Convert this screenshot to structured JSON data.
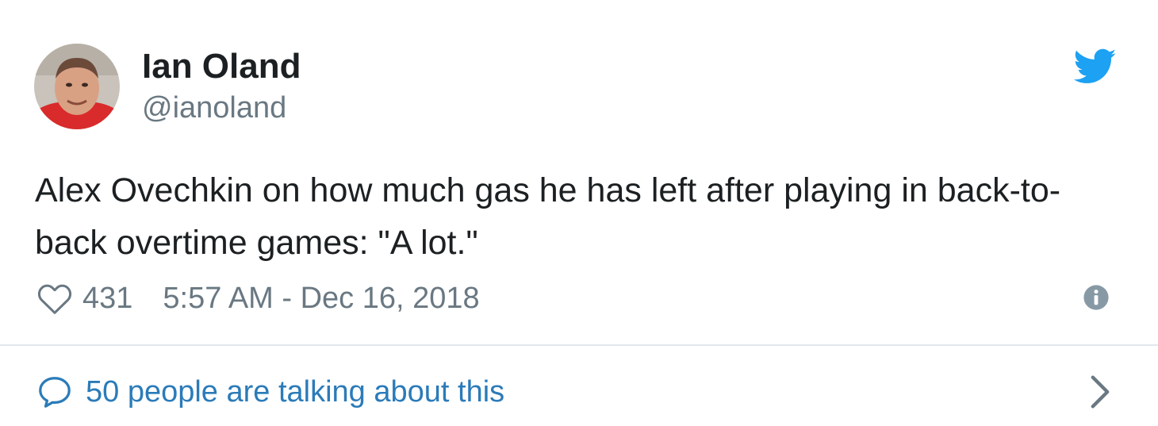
{
  "author": {
    "display_name": "Ian Oland",
    "handle": "@ianoland",
    "avatar_icon": "profile-photo"
  },
  "tweet": {
    "text": "Alex Ovechkin on how much gas he has left after playing in back-to-back overtime games: \"A lot.\""
  },
  "meta": {
    "like_icon": "heart-icon",
    "like_count": "431",
    "timestamp": "5:57 AM - Dec 16, 2018",
    "info_icon": "info-icon"
  },
  "conversation": {
    "icon": "speech-bubble-icon",
    "label": "50 people are talking about this",
    "chevron_icon": "chevron-right-icon"
  },
  "brand": {
    "logo_icon": "twitter-bird-icon",
    "color": "#1da1f2",
    "link_color": "#2b7bb9",
    "muted_color": "#697882"
  }
}
